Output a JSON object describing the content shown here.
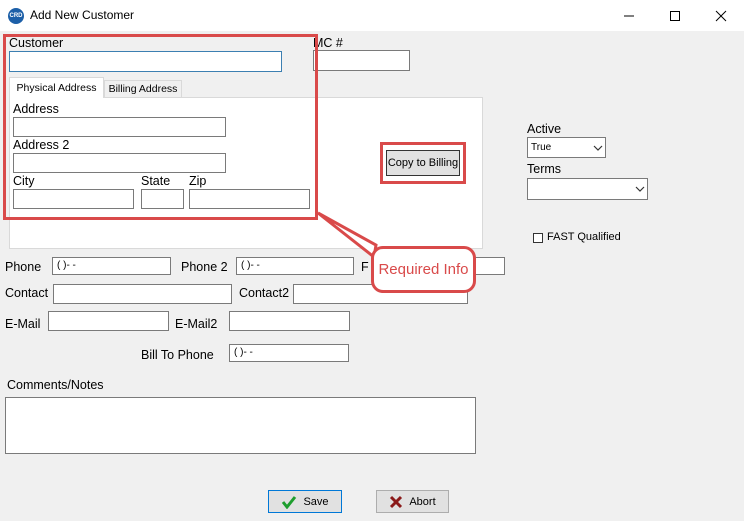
{
  "window": {
    "title": "Add New Customer",
    "icon_text": "CRD",
    "accent": "#1c5fa8"
  },
  "annotations": {
    "callout_text": "Required Info",
    "color": "#d94a4a"
  },
  "form": {
    "customer_label": "Customer",
    "customer_value": "",
    "mc_label": "MC #",
    "tabs": [
      "Physical Address",
      "Billing Address"
    ],
    "address_label": "Address",
    "address2_label": "Address 2",
    "city_label": "City",
    "state_label": "State",
    "zip_label": "Zip",
    "copy_button": "Copy to Billing",
    "active_label": "Active",
    "active_value": "True",
    "terms_label": "Terms",
    "terms_value": "",
    "fast_label": "FAST Qualified",
    "phone_label": "Phone",
    "phone_mask": "(   )-   -",
    "phone2_label": "Phone 2",
    "phone2_mask": "(   )-   -",
    "fax_label": "F",
    "contact_label": "Contact",
    "contact2_label": "Contact2",
    "email_label": "E-Mail",
    "email2_label": "E-Mail2",
    "billto_label": "Bill To Phone",
    "billto_mask": "(   )-   -",
    "comments_label": "Comments/Notes"
  },
  "buttons": {
    "save": "Save",
    "abort": "Abort"
  },
  "icons": {
    "check": "check-icon",
    "abort": "x-icon",
    "dropdown": "chevron-down-icon"
  }
}
